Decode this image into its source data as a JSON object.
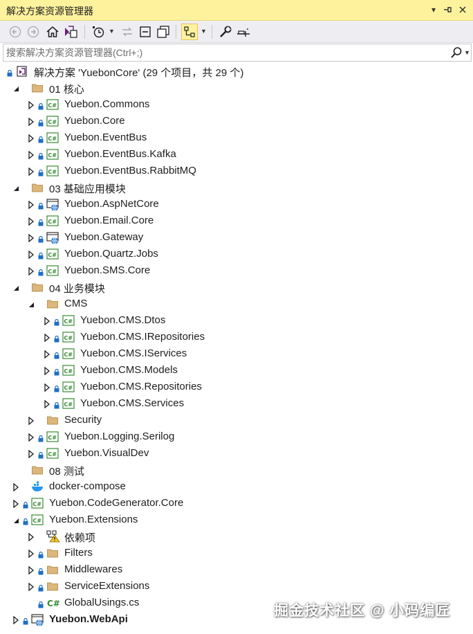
{
  "window": {
    "title": "解决方案资源管理器"
  },
  "search": {
    "placeholder": "搜索解决方案资源管理器(Ctrl+;)"
  },
  "tree": {
    "solution": {
      "label": "解决方案 'YuebonCore' (29 个项目，共 29 个)"
    },
    "items": [
      {
        "label": "01 核心",
        "type": "folder",
        "level": 1,
        "expanded": true
      },
      {
        "label": "Yuebon.Commons",
        "type": "csproj",
        "level": 2,
        "lock": true
      },
      {
        "label": "Yuebon.Core",
        "type": "csproj",
        "level": 2,
        "lock": true
      },
      {
        "label": "Yuebon.EventBus",
        "type": "csproj",
        "level": 2,
        "lock": true
      },
      {
        "label": "Yuebon.EventBus.Kafka",
        "type": "csproj",
        "level": 2,
        "lock": true
      },
      {
        "label": "Yuebon.EventBus.RabbitMQ",
        "type": "csproj",
        "level": 2,
        "lock": true
      },
      {
        "label": "03 基础应用模块",
        "type": "folder",
        "level": 1,
        "expanded": true
      },
      {
        "label": "Yuebon.AspNetCore",
        "type": "webproj",
        "level": 2,
        "lock": true
      },
      {
        "label": "Yuebon.Email.Core",
        "type": "csproj",
        "level": 2,
        "lock": true
      },
      {
        "label": "Yuebon.Gateway",
        "type": "webproj",
        "level": 2,
        "lock": true
      },
      {
        "label": "Yuebon.Quartz.Jobs",
        "type": "csproj",
        "level": 2,
        "lock": true
      },
      {
        "label": "Yuebon.SMS.Core",
        "type": "csproj",
        "level": 2,
        "lock": true
      },
      {
        "label": "04 业务模块",
        "type": "folder",
        "level": 1,
        "expanded": true
      },
      {
        "label": "CMS",
        "type": "folder",
        "level": 2,
        "expanded": true
      },
      {
        "label": "Yuebon.CMS.Dtos",
        "type": "csproj",
        "level": 3,
        "lock": true
      },
      {
        "label": "Yuebon.CMS.IRepositories",
        "type": "csproj",
        "level": 3,
        "lock": true
      },
      {
        "label": "Yuebon.CMS.IServices",
        "type": "csproj",
        "level": 3,
        "lock": true
      },
      {
        "label": "Yuebon.CMS.Models",
        "type": "csproj",
        "level": 3,
        "lock": true
      },
      {
        "label": "Yuebon.CMS.Repositories",
        "type": "csproj",
        "level": 3,
        "lock": true
      },
      {
        "label": "Yuebon.CMS.Services",
        "type": "csproj",
        "level": 3,
        "lock": true
      },
      {
        "label": "Security",
        "type": "folder",
        "level": 2,
        "expanded": false
      },
      {
        "label": "Yuebon.Logging.Serilog",
        "type": "csproj",
        "level": 2,
        "lock": true
      },
      {
        "label": "Yuebon.VisualDev",
        "type": "csproj",
        "level": 2,
        "lock": true
      },
      {
        "label": "08 测试",
        "type": "folder",
        "level": 1,
        "noexp": true
      },
      {
        "label": "docker-compose",
        "type": "docker",
        "level": 1
      },
      {
        "label": "Yuebon.CodeGenerator.Core",
        "type": "csproj",
        "level": 1,
        "lock": true
      },
      {
        "label": "Yuebon.Extensions",
        "type": "csproj",
        "level": 1,
        "lock": true,
        "expanded": true
      },
      {
        "label": "依赖项",
        "type": "deps",
        "level": 2
      },
      {
        "label": "Filters",
        "type": "folder",
        "level": 2,
        "lock": true
      },
      {
        "label": "Middlewares",
        "type": "folder",
        "level": 2,
        "lock": true
      },
      {
        "label": "ServiceExtensions",
        "type": "folder",
        "level": 2,
        "lock": true
      },
      {
        "label": "GlobalUsings.cs",
        "type": "csfile",
        "level": 2,
        "lock": true,
        "noexp": true
      },
      {
        "label": "Yuebon.WebApi",
        "type": "webproj",
        "level": 1,
        "lock": true,
        "bold": true
      }
    ]
  },
  "watermark": "掘金技术社区 @ 小码编匠",
  "colors": {
    "titlebar": "#fff29d",
    "toolbar": "#eeeef2",
    "folder": "#dcb67a",
    "csharp_green": "#388a34",
    "web_blue": "#1f6fc5"
  }
}
